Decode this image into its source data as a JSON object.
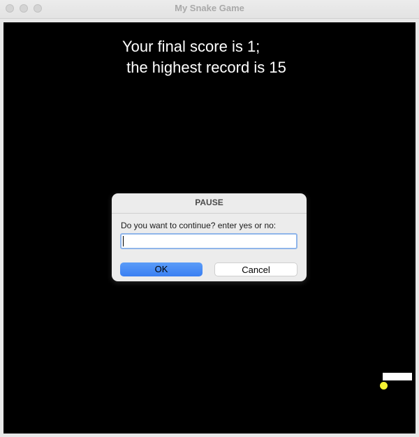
{
  "window": {
    "title": "My Snake Game"
  },
  "game": {
    "score_line1": "Your final score is 1;",
    "score_line2": " the highest record is 15"
  },
  "dialog": {
    "title": "PAUSE",
    "prompt": "Do you want to continue? enter yes or no:",
    "input_value": "",
    "ok_label": "OK",
    "cancel_label": "Cancel"
  },
  "colors": {
    "canvas": "#000000",
    "text": "#ffffff",
    "food": "#f5f232",
    "snake": "#ffffff",
    "ok_button": "#3a7ff2"
  }
}
